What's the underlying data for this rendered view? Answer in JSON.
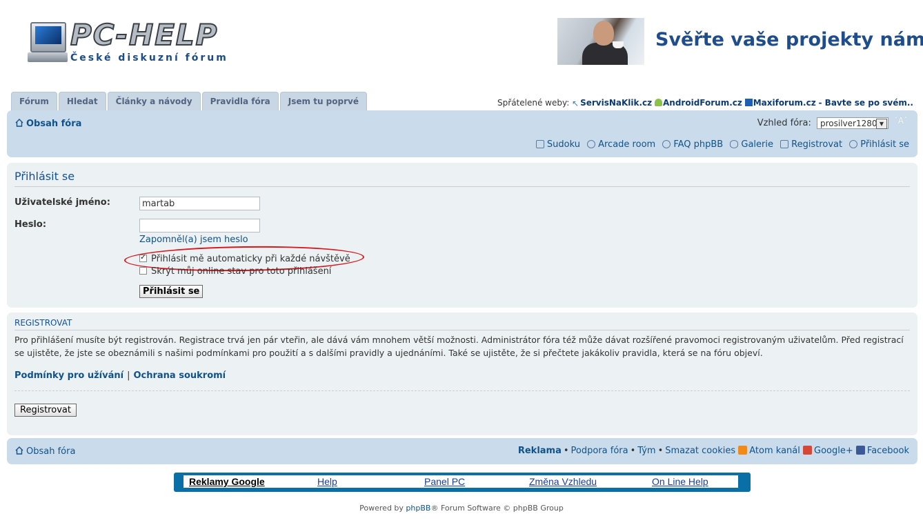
{
  "header": {
    "logo_brand": "PC-HELP",
    "logo_tagline": "České diskuzní fórum",
    "banner_slogan": "Svěřte vaše projekty nám"
  },
  "tabs": [
    {
      "label": "Fórum"
    },
    {
      "label": "Hledat"
    },
    {
      "label": "Články a návody"
    },
    {
      "label": "Pravidla fóra"
    },
    {
      "label": "Jsem tu poprvé"
    }
  ],
  "friends": {
    "label": "Spřátelené weby:",
    "sites": [
      "ServisNaKlik.cz",
      "AndroidForum.cz",
      "Maxiforum.cz"
    ],
    "tail": "- Bavte se po svém.."
  },
  "navbar": {
    "breadcrumb": "Obsah fóra",
    "style_label": "Vzhled fóra:",
    "style_value": "prosilver1280",
    "fontsize": "ˇAˆ",
    "quick_links": [
      {
        "label": "Sudoku",
        "icon": "grid-icon"
      },
      {
        "label": "Arcade room",
        "icon": "users-icon"
      },
      {
        "label": "FAQ phpBB",
        "icon": "help-icon"
      },
      {
        "label": "Galerie",
        "icon": "eye-icon"
      },
      {
        "label": "Registrovat",
        "icon": "register-icon"
      },
      {
        "label": "Přihlásit se",
        "icon": "power-icon"
      }
    ]
  },
  "login": {
    "title": "Přihlásit se",
    "username_label": "Uživatelské jméno:",
    "username_value": "martab",
    "password_label": "Heslo:",
    "password_value": "",
    "forgot_link": "Zapomněl(a) jsem heslo",
    "autologin_label": "Přihlásit mě automaticky při každé návštěvě",
    "autologin_checked": true,
    "hide_online_label": "Skrýt můj online stav pro toto přihlášení",
    "hide_online_checked": false,
    "submit_label": "Přihlásit se"
  },
  "register": {
    "title": "Registrovat",
    "text": "Pro přihlášení musíte být registrován. Registrace trvá jen pár vteřin, ale dává vám mnohem větší možnosti. Administrátor fóra též může dávat rozšířené pravomoci registrovaným uživatelům. Před registrací se ujistěte, že jste se obeznámili s našimi podmínkami pro použití a s dalšími pravidly a ujednáními. Také se ujistěte, že si přečtete jakákoliv pravidla, která se na fóru objeví.",
    "terms_link": "Podmínky pro užívání",
    "privacy_link": "Ochrana soukromí",
    "separator": "|",
    "button_label": "Registrovat"
  },
  "footer": {
    "breadcrumb": "Obsah fóra",
    "links": [
      "Reklama",
      "Podpora fóra",
      "Tým",
      "Smazat cookies"
    ],
    "atom": "Atom kanál",
    "google": "Google+",
    "facebook": "Facebook",
    "dot": "•"
  },
  "adbar": {
    "links": [
      "Reklamy Google",
      "Help",
      "Panel PC",
      "Změna Vzhledu",
      "On Line Help"
    ]
  },
  "powered": {
    "prefix": "Powered by",
    "link": "phpBB",
    "suffix": "® Forum Software © phpBB Group"
  },
  "colors": {
    "navbar_bg": "#cadceb",
    "panel_bg": "#ecf1f3",
    "link": "#105289",
    "highlight_circle": "#d9141a",
    "adbar_bg": "#0a6fa6"
  }
}
